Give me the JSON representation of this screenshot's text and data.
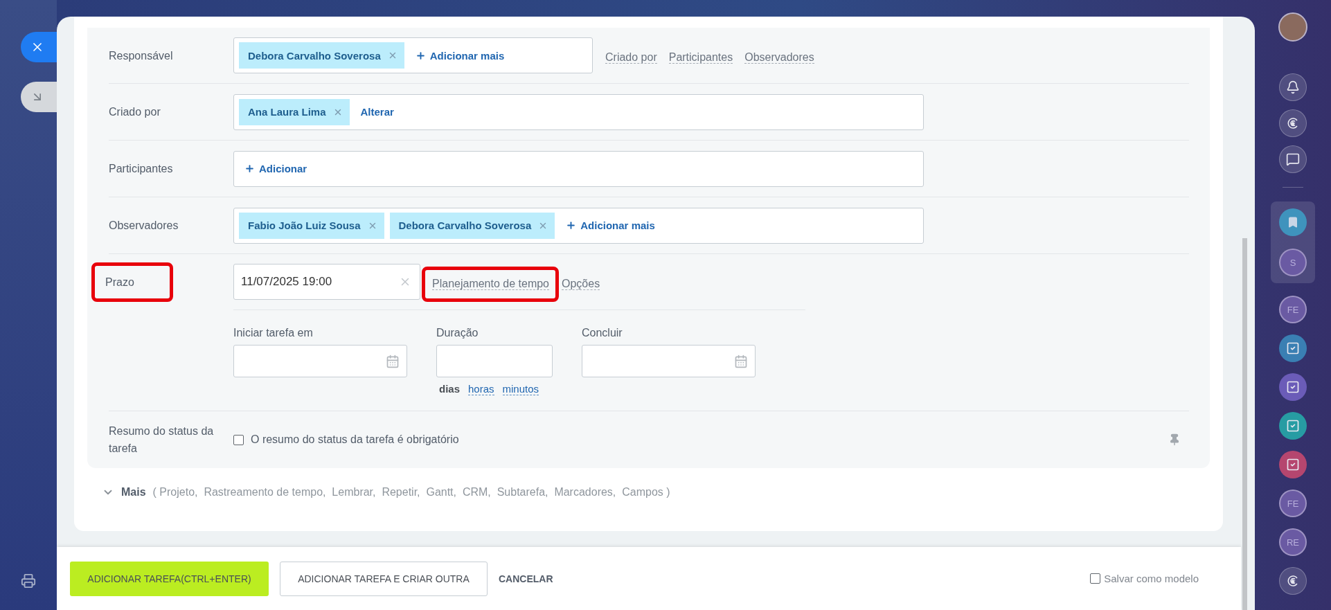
{
  "fields": [
    {
      "label": "Responsável",
      "kind": "people",
      "tags": [
        "Debora Carvalho Soverosa"
      ],
      "action": {
        "text": "Adicionar mais",
        "kind": "add"
      },
      "links": [
        "Criado por",
        "Participantes",
        "Observadores"
      ]
    },
    {
      "label": "Criado por",
      "kind": "people",
      "tags": [
        "Ana Laura Lima"
      ],
      "action": {
        "text": "Alterar",
        "kind": "change"
      }
    },
    {
      "label": "Participantes",
      "kind": "people",
      "action": {
        "text": "Adicionar",
        "kind": "add"
      }
    },
    {
      "label": "Observadores",
      "kind": "people",
      "tags": [
        "Fabio João Luiz Sousa",
        "Debora Carvalho Soverosa"
      ],
      "action": {
        "text": "Adicionar mais",
        "kind": "add"
      }
    }
  ],
  "deadline": {
    "label": "Prazo",
    "highlighted": true,
    "value": "11/07/2025 19:00",
    "links": [
      {
        "text": "Planejamento de tempo",
        "highlighted": true
      },
      {
        "text": "Opções",
        "highlighted": false
      }
    ]
  },
  "time_planning": {
    "fields": [
      {
        "label": "Iniciar tarefa em",
        "kind": "date"
      },
      {
        "label": "Duração",
        "kind": "number"
      },
      {
        "label": "Concluir",
        "kind": "date"
      }
    ],
    "units": [
      {
        "text": "dias",
        "selected": true
      },
      {
        "text": "horas",
        "selected": false
      },
      {
        "text": "minutos",
        "selected": false
      }
    ]
  },
  "status_summary": {
    "label": "Resumo do status da tarefa",
    "checkbox_label": "O resumo do status da tarefa é obrigatório",
    "checked": false
  },
  "more": {
    "label": "Mais",
    "expanded": false,
    "summary": "( Projeto,  Rastreamento de tempo,  Lembrar,  Repetir,  Gantt,  CRM,  Subtarefa,  Marcadores,  Campos )"
  },
  "footer": {
    "buttons": [
      {
        "text": "ADICIONAR TAREFA(CTRL+ENTER)",
        "kind": "primary"
      },
      {
        "text": "ADICIONAR TAREFA E CRIAR OUTRA",
        "kind": "secondary"
      },
      {
        "text": "CANCELAR",
        "kind": "link"
      }
    ],
    "save_template": {
      "label": "Salvar como modelo",
      "checked": false
    }
  },
  "right_sidebar": {
    "tools": [
      {
        "kind": "bell"
      },
      {
        "kind": "copilot"
      },
      {
        "kind": "chat"
      }
    ],
    "pinned": [
      {
        "kind": "bookmark",
        "color": "#3f93bd"
      },
      {
        "kind": "initials",
        "text": "S"
      }
    ],
    "recent": [
      {
        "kind": "initials",
        "text": "FE"
      },
      {
        "kind": "task",
        "color": "#3a7fb3"
      },
      {
        "kind": "task",
        "color": "#6b5cb8"
      },
      {
        "kind": "task",
        "color": "#279ca3"
      },
      {
        "kind": "task",
        "color": "#b5466f"
      },
      {
        "kind": "initials",
        "text": "FE"
      },
      {
        "kind": "initials",
        "text": "RE"
      },
      {
        "kind": "copilot"
      }
    ]
  }
}
